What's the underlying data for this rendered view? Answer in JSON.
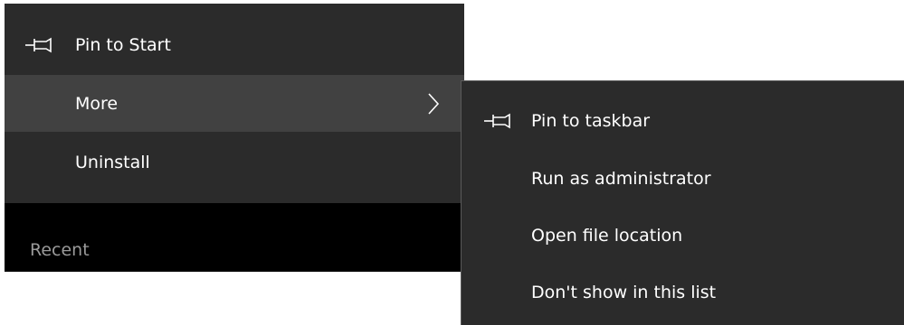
{
  "primary_menu": {
    "items": [
      {
        "label": "Pin to Start",
        "icon": "pin-icon"
      },
      {
        "label": "More",
        "icon": "chevron-right-icon",
        "highlighted": true
      },
      {
        "label": "Uninstall"
      }
    ]
  },
  "start_panel": {
    "section_header": "Recent"
  },
  "submenu": {
    "items": [
      {
        "label": "Pin to taskbar",
        "icon": "pin-icon"
      },
      {
        "label": "Run as administrator"
      },
      {
        "label": "Open file location"
      },
      {
        "label": "Don't show in this list"
      }
    ]
  },
  "colors": {
    "menu_background": "#2b2b2b",
    "hover_background": "#414141",
    "panel_background": "#000000",
    "text": "#ffffff",
    "muted_text": "#9a9a9a"
  }
}
